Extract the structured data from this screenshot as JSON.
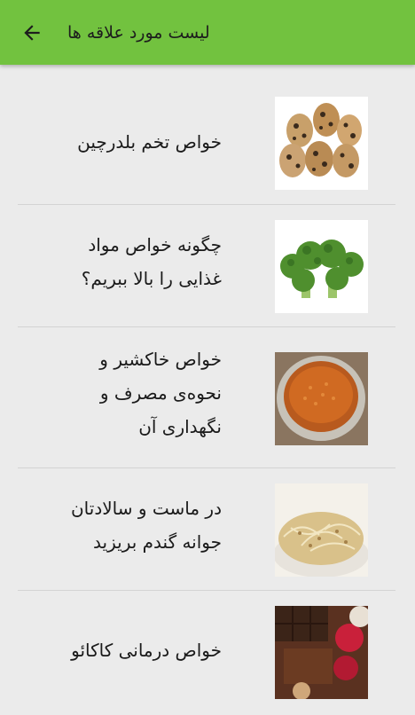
{
  "header": {
    "title": "لیست مورد علاقه ها",
    "back_icon": "arrow-left-icon",
    "background": "#72c23f"
  },
  "favorites": [
    {
      "title": "خواص تخم بلدرچین",
      "image": "quail-eggs-image"
    },
    {
      "title": "چگونه خواص مواد\nغذایی را بالا ببریم؟",
      "image": "broccoli-image"
    },
    {
      "title": "خواص خاکشیر و\nنحوه‌ی مصرف و\nنگهداری آن",
      "image": "khakshir-seeds-image"
    },
    {
      "title": "در ماست و سالادتان\nجوانه گندم بریزید",
      "image": "wheat-sprouts-image"
    },
    {
      "title": "خواص درمانی کاکائو",
      "image": "cocoa-chocolate-image"
    }
  ]
}
